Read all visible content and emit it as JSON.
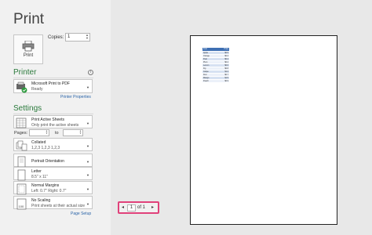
{
  "title": "Print",
  "print_button": {
    "label": "Print",
    "icon": "printer-icon"
  },
  "copies": {
    "label": "Copies:",
    "value": "1"
  },
  "printer": {
    "heading": "Printer",
    "name": "Microsoft Print to PDF",
    "status": "Ready",
    "properties_link": "Printer Properties"
  },
  "settings": {
    "heading": "Settings",
    "items": [
      {
        "title": "Print Active Sheets",
        "subtitle": "Only print the active sheets",
        "icon": "sheets-icon"
      },
      {
        "title": "Collated",
        "subtitle": "1,2,3    1,2,3    1,2,3",
        "icon": "collate-icon"
      },
      {
        "title": "Portrait Orientation",
        "subtitle": "",
        "icon": "portrait-icon"
      },
      {
        "title": "Letter",
        "subtitle": "8.5\" x 11\"",
        "icon": "paper-icon"
      },
      {
        "title": "Normal Margins",
        "subtitle": "Left: 0.7\"   Right: 0.7\"",
        "icon": "margins-icon"
      },
      {
        "title": "No Scaling",
        "subtitle": "Print sheets at their actual size",
        "icon": "scaling-icon"
      }
    ],
    "pages_label": "Pages:",
    "to_label": "to",
    "pages_from": "",
    "pages_to": "",
    "page_setup_link": "Page Setup"
  },
  "preview": {
    "table": [
      {
        "name": "Fruit",
        "value": "Price",
        "header": true
      },
      {
        "name": "Apple",
        "value": "$0.5"
      },
      {
        "name": "Orange",
        "value": "$0.3"
      },
      {
        "name": "Pear",
        "value": "$0.4"
      },
      {
        "name": "Plum",
        "value": "$0.2"
      },
      {
        "name": "Lemon",
        "value": "$0.6"
      },
      {
        "name": "Fig",
        "value": "$0.8"
      },
      {
        "name": "Grape",
        "value": "$1.2"
      },
      {
        "name": "Kiwi",
        "value": "$0.7"
      },
      {
        "name": "Mango",
        "value": "$1.5"
      },
      {
        "name": "Peach",
        "value": "$0.9"
      }
    ]
  },
  "nav": {
    "prev": "◂",
    "page": "1",
    "of_label": "of 1",
    "next": "▸"
  },
  "colors": {
    "accent": "#2b7a3c",
    "highlight": "#e0417a",
    "link": "#2a64a8"
  }
}
